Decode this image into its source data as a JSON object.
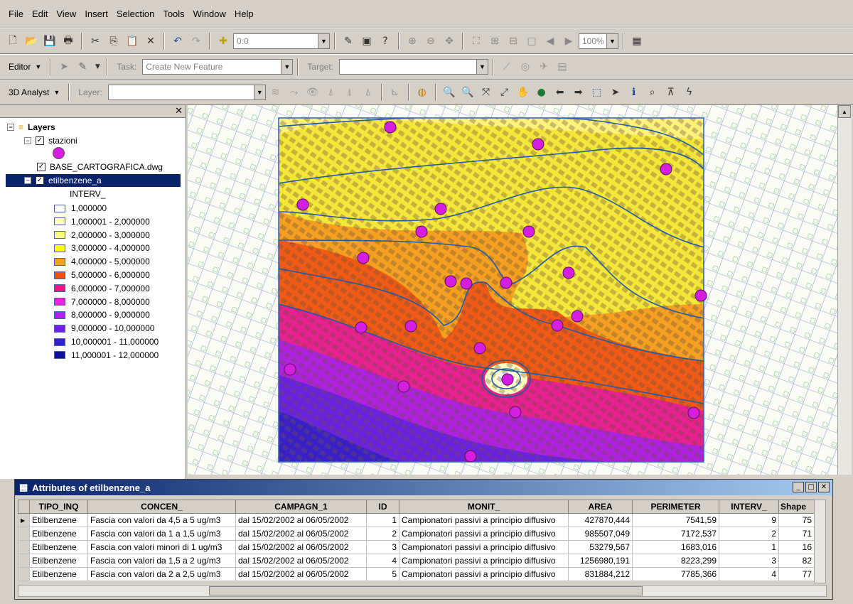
{
  "menu": [
    "File",
    "Edit",
    "View",
    "Insert",
    "Selection",
    "Tools",
    "Window",
    "Help"
  ],
  "toolbar1": {
    "scale_value": "0:0",
    "zoom_value": "100%"
  },
  "editor_toolbar": {
    "editor_label": "Editor",
    "task_label": "Task:",
    "task_value": "Create New Feature",
    "target_label": "Target:"
  },
  "analyst_toolbar": {
    "label": "3D Analyst",
    "layer_label": "Layer:"
  },
  "toc": {
    "root": "Layers",
    "layer1": "stazioni",
    "layer2": "BASE_CARTOGRAFICA.dwg",
    "layer3": "etilbenzene_a",
    "field": "INTERV_",
    "legend": [
      {
        "label": "1,000000",
        "color": "#ffffff"
      },
      {
        "label": "1,000001 - 2,000000",
        "color": "#ffffc0"
      },
      {
        "label": "2,000000 - 3,000000",
        "color": "#ffff80"
      },
      {
        "label": "3,000000 - 4,000000",
        "color": "#ffff00"
      },
      {
        "label": "4,000000 - 5,000000",
        "color": "#f4a020"
      },
      {
        "label": "5,000000 - 6,000000",
        "color": "#f05010"
      },
      {
        "label": "6,000000 - 7,000000",
        "color": "#f01880"
      },
      {
        "label": "7,000000 - 8,000000",
        "color": "#f020e0"
      },
      {
        "label": "8,000000 - 9,000000",
        "color": "#b020f0"
      },
      {
        "label": "9,000000 - 10,000000",
        "color": "#7020f0"
      },
      {
        "label": "10,000001 - 11,000000",
        "color": "#3020d0"
      },
      {
        "label": "11,000001 - 12,000000",
        "color": "#1010a0"
      }
    ]
  },
  "attr": {
    "title": "Attributes of etilbenzene_a",
    "columns": [
      "TIPO_INQ",
      "CONCEN_",
      "CAMPAGN_1",
      "ID",
      "MONIT_",
      "AREA",
      "PERIMETER",
      "INTERV_",
      "Shape"
    ],
    "rows": [
      [
        "Etilbenzene",
        "Fascia con valori da 4,5 a 5 ug/m3",
        "dal 15/02/2002 al 06/05/2002",
        "1",
        "Campionatori passivi a principio diffusivo",
        "427870,444",
        "7541,59",
        "9",
        "75"
      ],
      [
        "Etilbenzene",
        "Fascia con valori da 1 a 1,5 ug/m3",
        "dal 15/02/2002 al 06/05/2002",
        "2",
        "Campionatori passivi a principio diffusivo",
        "985507,049",
        "7172,537",
        "2",
        "71"
      ],
      [
        "Etilbenzene",
        "Fascia con valori minori di 1 ug/m3",
        "dal 15/02/2002 al 06/05/2002",
        "3",
        "Campionatori passivi a principio diffusivo",
        "53279,567",
        "1683,016",
        "1",
        "16"
      ],
      [
        "Etilbenzene",
        "Fascia con valori da 1,5 a 2 ug/m3",
        "dal 15/02/2002 al 06/05/2002",
        "4",
        "Campionatori passivi a principio diffusivo",
        "1256980,191",
        "8223,299",
        "3",
        "82"
      ],
      [
        "Etilbenzene",
        "Fascia con valori da 2 a 2,5 ug/m3",
        "dal 15/02/2002 al 06/05/2002",
        "5",
        "Campionatori passivi a principio diffusivo",
        "831884,212",
        "7785,366",
        "4",
        "77"
      ]
    ]
  }
}
